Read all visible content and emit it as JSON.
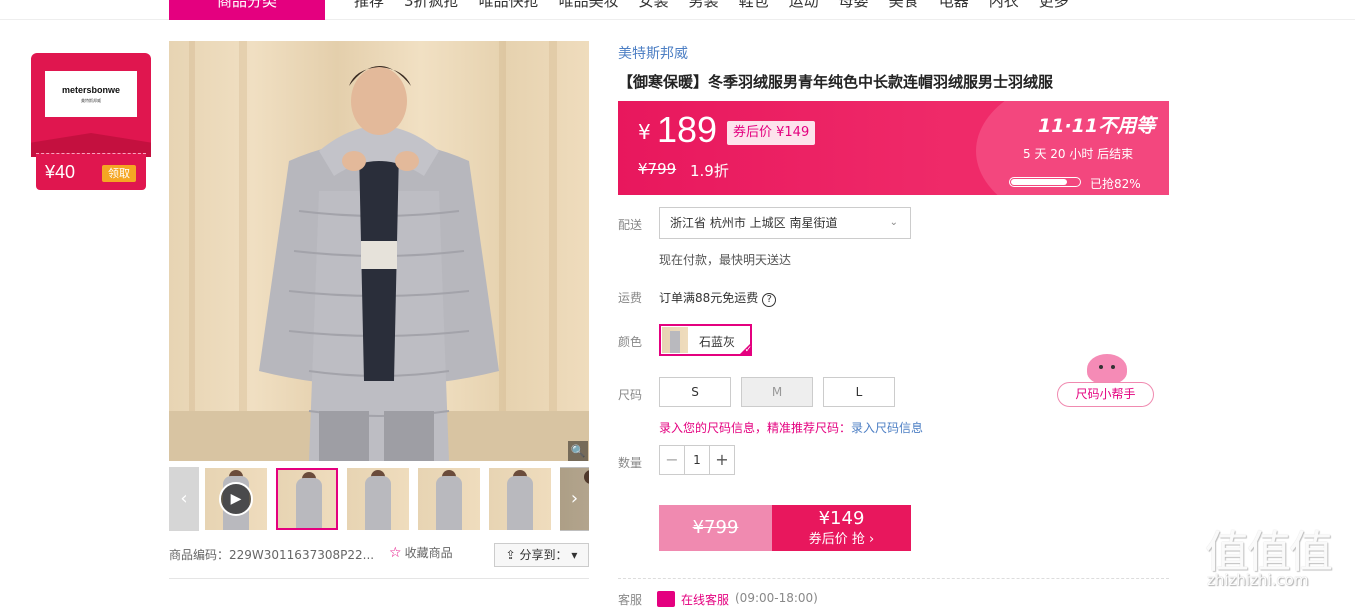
{
  "nav": {
    "category_button": "商品分类",
    "items": [
      "推荐",
      "3折疯抢",
      "唯品快抢",
      "唯品美妆",
      "女装",
      "男装",
      "鞋包",
      "运动",
      "母婴",
      "美食",
      "电器",
      "内衣",
      "更多"
    ]
  },
  "coupon": {
    "brand_logo": "metersbonwe",
    "brand_logo_sub": "美特斯邦威",
    "amount": "¥40",
    "get_label": "领取"
  },
  "gallery": {
    "zoom_icon": "magnifier-icon",
    "product_code": "商品编码：229W3011637308P22...",
    "favorite_label": "收藏商品",
    "share_label": "分享到："
  },
  "product": {
    "brand": "美特斯邦威",
    "title": "【御寒保暖】冬季羽绒服男青年纯色中长款连帽羽绒服男士羽绒服"
  },
  "price": {
    "currency": "¥",
    "current": "189",
    "after_coupon": "券后价 ¥149",
    "original": "¥799",
    "discount": "1.9折",
    "promo": "11·11不用等",
    "countdown": "5  天  20  小时  后结束",
    "grabbed": "已抢82%",
    "progress_percent": 82
  },
  "delivery": {
    "label": "配送",
    "address": "浙江省 杭州市 上城区 南星街道",
    "note": "现在付款，最快明天送达"
  },
  "shipping": {
    "label": "运费",
    "text": "订单满88元免运费"
  },
  "color": {
    "label": "颜色",
    "selected": "石蓝灰"
  },
  "size": {
    "label": "尺码",
    "options": [
      "S",
      "M",
      "L"
    ],
    "tip": "录入您的尺码信息，精准推荐尺码：",
    "tip_link": "录入尺码信息"
  },
  "quantity": {
    "label": "数量",
    "value": "1",
    "minus": "−",
    "plus": "+"
  },
  "buy": {
    "original": "¥799",
    "price": "¥149",
    "label": "券后价 抢 ›"
  },
  "service": {
    "label": "客服",
    "link": "在线客服",
    "hours": "(09:00-18:00)"
  },
  "helper": {
    "label": "尺码小帮手"
  },
  "watermark": {
    "big": "值值值",
    "small": "zhizhizhi.com"
  },
  "colors": {
    "accent": "#e4007f",
    "price_bg": "#e8175d",
    "link": "#4d7fc4"
  }
}
